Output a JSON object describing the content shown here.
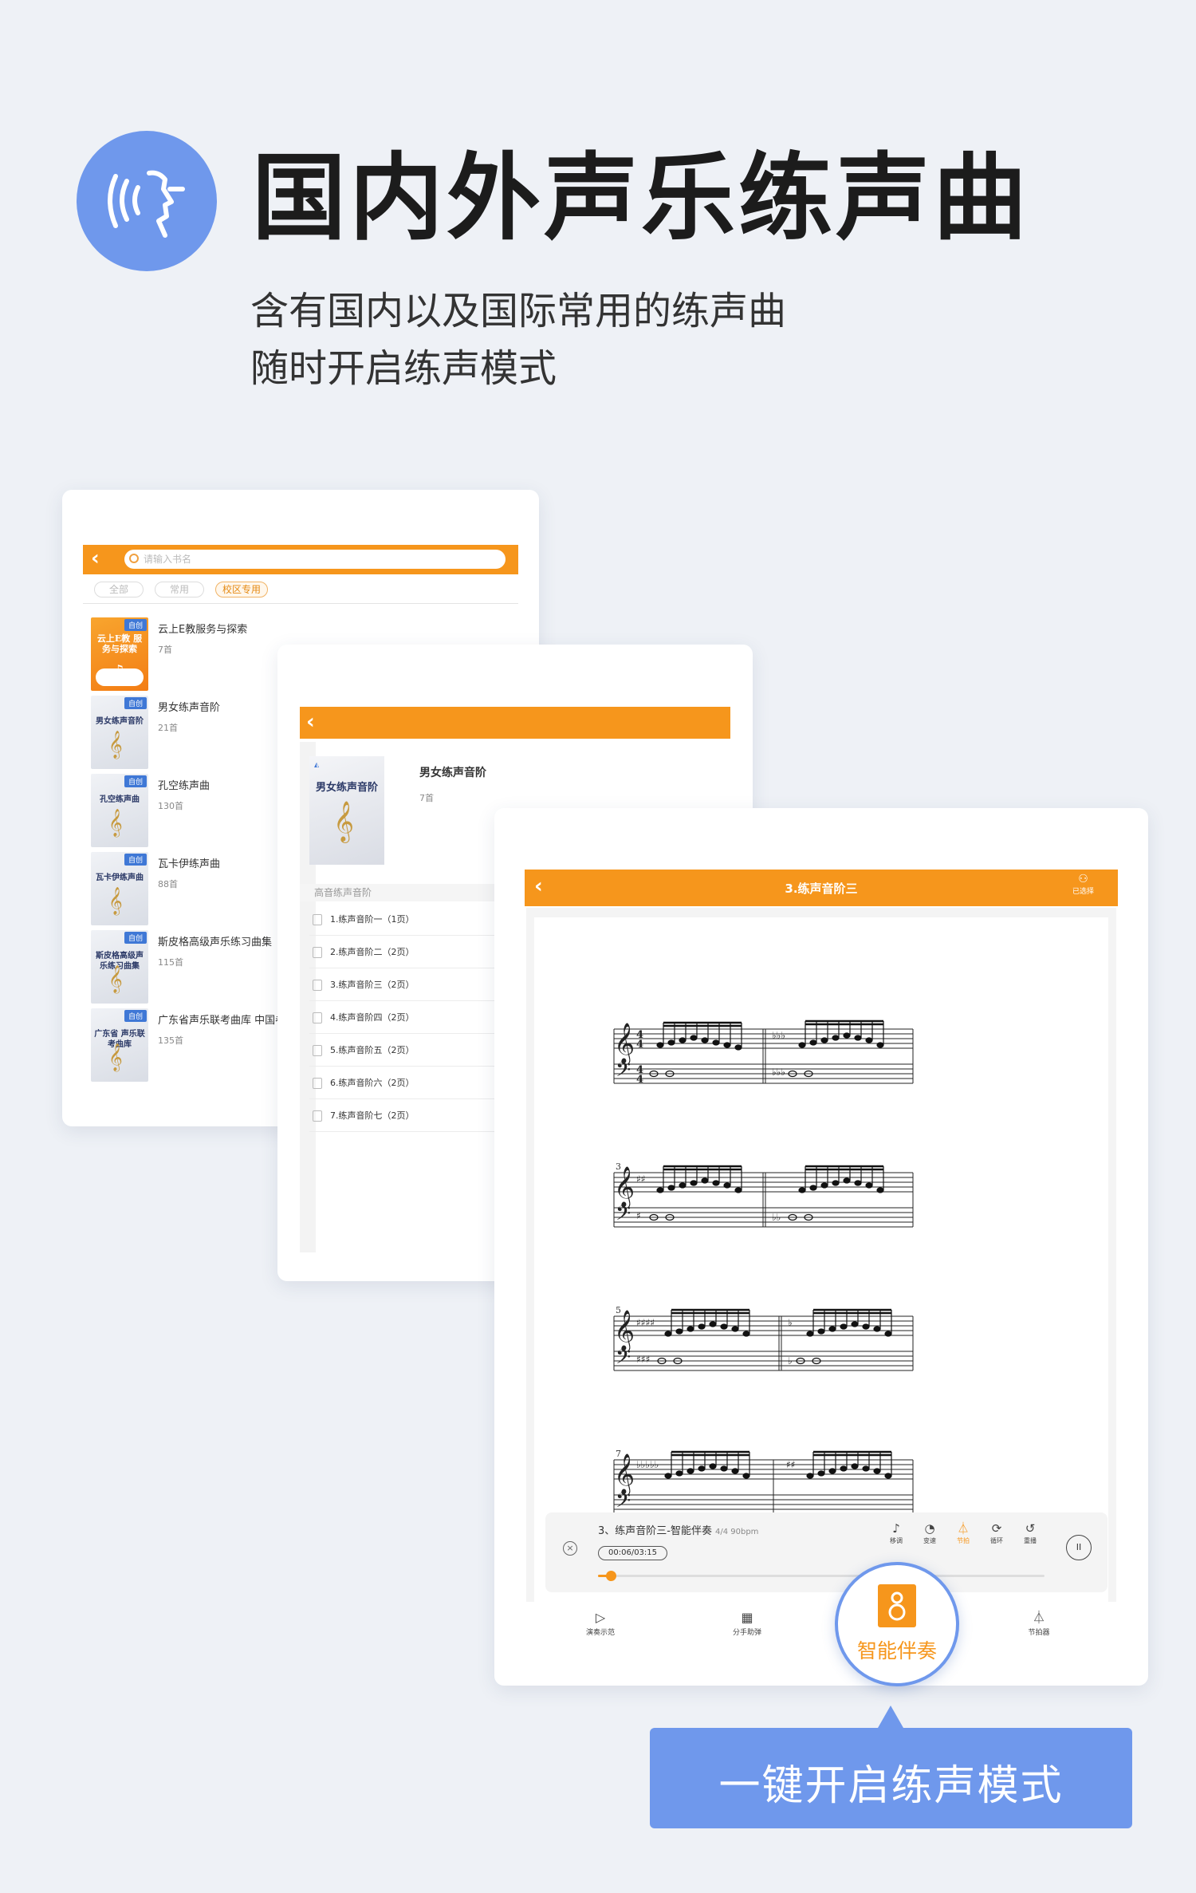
{
  "hero": {
    "title": "国内外声乐练声曲",
    "subtitle_line1": "含有国内以及国际常用的练声曲",
    "subtitle_line2": "随时开启练声模式"
  },
  "list_screen": {
    "back": "‹",
    "search_placeholder": "请输入书名",
    "filters": [
      "全部",
      "常用",
      "校区专用"
    ],
    "books": [
      {
        "tag": "自创",
        "cover_title": "云上E教 服务与探索",
        "title": "云上E教服务与探索",
        "count": "7首"
      },
      {
        "tag": "自创",
        "cover_title": "男女练声音阶",
        "title": "男女练声音阶",
        "count": "21首"
      },
      {
        "tag": "自创",
        "cover_title": "孔空练声曲",
        "title": "孔空练声曲",
        "count": "130首"
      },
      {
        "tag": "自创",
        "cover_title": "瓦卡伊练声曲",
        "title": "瓦卡伊练声曲",
        "count": "88首"
      },
      {
        "tag": "自创",
        "cover_title": "斯皮格高级声乐练习曲集",
        "title": "斯皮格高级声乐练习曲集",
        "count": "115首"
      },
      {
        "tag": "自创",
        "cover_title": "广东省 声乐联考曲库",
        "title": "广东省声乐联考曲库 中国卷",
        "count": "135首"
      }
    ]
  },
  "detail_screen": {
    "back": "‹",
    "cover_title": "男女练声音阶",
    "title": "男女练声音阶",
    "count": "7首",
    "section": "高音练声音阶",
    "lessons": [
      "1.练声音阶一（1页）",
      "2.练声音阶二（2页）",
      "3.练声音阶三（2页）",
      "4.练声音阶四（2页）",
      "5.练声音阶五（2页）",
      "6.练声音阶六（2页）",
      "7.练声音阶七（2页）"
    ]
  },
  "score_screen": {
    "back": "‹",
    "title": "3.练声音阶三",
    "chosen": "已选择",
    "measures": [
      "3",
      "5",
      "7"
    ],
    "player": {
      "close": "×",
      "title": "3、练声音阶三-智能伴奏",
      "meta": "4/4 90bpm",
      "time": "00:06/03:15",
      "progress": 0.028,
      "pause": "II",
      "tools": [
        {
          "icon": "♪",
          "label": "移调",
          "on": false
        },
        {
          "icon": "◔",
          "label": "变速",
          "on": false
        },
        {
          "icon": "⏃",
          "label": "节拍",
          "on": true
        },
        {
          "icon": "⟳",
          "label": "循环",
          "on": false
        },
        {
          "icon": "↺",
          "label": "重播",
          "on": false
        }
      ]
    },
    "nav": [
      {
        "icon": "▷",
        "label": "演奏示范"
      },
      {
        "icon": "▦",
        "label": "分手助弹"
      },
      {
        "icon": "⏃",
        "label": "节拍器"
      }
    ]
  },
  "highlight": {
    "label": "智能伴奏",
    "callout": "一键开启练声模式"
  },
  "colors": {
    "accent": "#f6961c",
    "brand_blue": "#6f98ec",
    "background": "#eef1f6"
  }
}
